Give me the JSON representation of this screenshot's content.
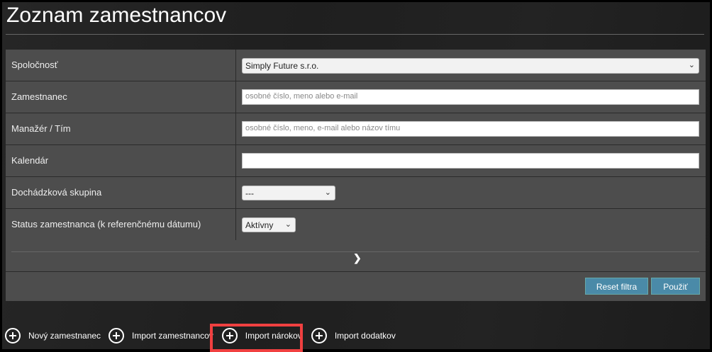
{
  "title": "Zoznam zamestnancov",
  "filters": {
    "company": {
      "label": "Spoločnosť",
      "value": "Simply Future s.r.o."
    },
    "employee": {
      "label": "Zamestnanec",
      "placeholder": "osobné číslo, meno alebo e-mail"
    },
    "manager": {
      "label": "Manažér / Tím",
      "placeholder": "osobné číslo, meno, e-mail alebo názov tímu"
    },
    "calendar": {
      "label": "Kalendár",
      "value": ""
    },
    "group": {
      "label": "Dochádzková skupina",
      "value": "---"
    },
    "status": {
      "label": "Status zamestnanca (k referenčnému dátumu)",
      "value": "Aktívny"
    }
  },
  "buttons": {
    "reset": "Reset filtra",
    "apply": "Použiť"
  },
  "actions": [
    "Nový zamestnanec",
    "Import zamestnancov",
    "Import nárokov",
    "Import dodatkov"
  ],
  "colors": {
    "button": "#4a8aa8",
    "highlight": "#f04040"
  }
}
